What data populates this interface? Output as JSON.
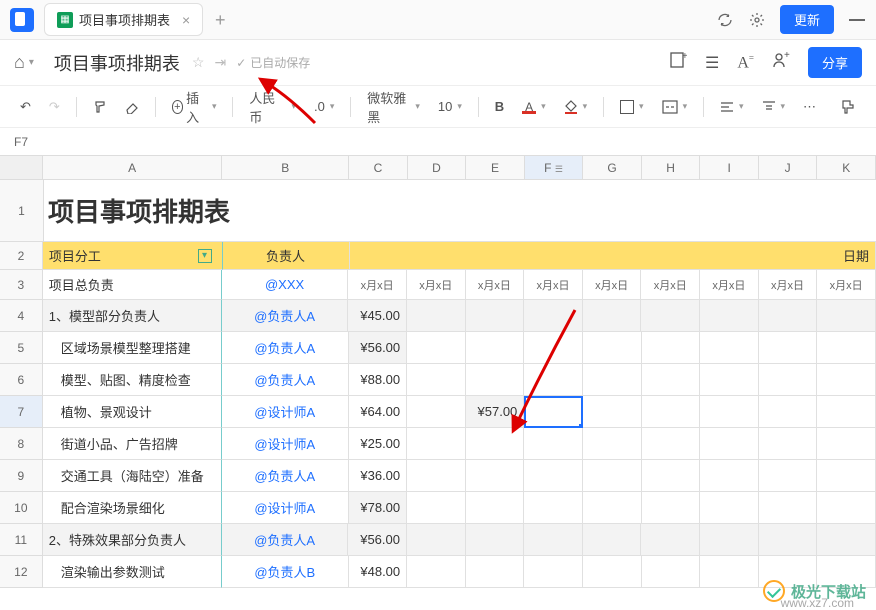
{
  "titlebar": {
    "tab_title": "项目事项排期表",
    "update_label": "更新"
  },
  "header": {
    "doc_title": "项目事项排期表",
    "saved_label": "已自动保存",
    "share_label": "分享"
  },
  "toolbar": {
    "insert_label": "插入",
    "currency_label": "人民币",
    "decimal_label": ".0",
    "font_label": "微软雅黑",
    "font_size": "10",
    "bold": "B",
    "text_color": "A"
  },
  "cellref": "F7",
  "columns": [
    "A",
    "B",
    "C",
    "D",
    "E",
    "F",
    "G",
    "H",
    "I",
    "J",
    "K"
  ],
  "col_widths": {
    "A": 184,
    "B": 130,
    "C": 60,
    "D": 60,
    "E": 60,
    "F": 60,
    "G": 60,
    "H": 60,
    "I": 60,
    "J": 60,
    "K": 60
  },
  "table_title": "项目事项排期表",
  "headers": {
    "a": "项目分工",
    "b": "负责人",
    "date": "日期"
  },
  "date_sub": "x月x日",
  "rows": [
    {
      "n": 3,
      "a": "项目总负责",
      "b": "@XXX",
      "c": "",
      "sub": true
    },
    {
      "n": 4,
      "a": "1、模型部分负责人",
      "b": "@负责人A",
      "c": "¥45.00",
      "gray": true
    },
    {
      "n": 5,
      "a": "区域场景模型整理搭建",
      "b": "@负责人A",
      "c": "¥56.00",
      "indent": true
    },
    {
      "n": 6,
      "a": "模型、贴图、精度检查",
      "b": "@负责人A",
      "c": "¥88.00",
      "indent": true
    },
    {
      "n": 7,
      "a": "植物、景观设计",
      "b": "@设计师A",
      "c": "¥64.00",
      "e": "¥57.00",
      "indent": true,
      "sel": true
    },
    {
      "n": 8,
      "a": "街道小品、广告招牌",
      "b": "@设计师A",
      "c": "¥25.00",
      "indent": true
    },
    {
      "n": 9,
      "a": "交通工具（海陆空）准备",
      "b": "@负责人A",
      "c": "¥36.00",
      "indent": true
    },
    {
      "n": 10,
      "a": "配合渲染场景细化",
      "b": "@设计师A",
      "c": "¥78.00",
      "indent": true
    },
    {
      "n": 11,
      "a": "2、特殊效果部分负责人",
      "b": "@负责人A",
      "c": "¥56.00",
      "gray": true
    },
    {
      "n": 12,
      "a": "渲染输出参数测试",
      "b": "@负责人B",
      "c": "¥48.00",
      "indent": true
    }
  ],
  "watermark": {
    "text": "极光下载站",
    "url": "www.xz7.com"
  },
  "chart_data": {
    "type": "table",
    "title": "项目事项排期表",
    "columns": [
      "项目分工",
      "负责人",
      "C",
      "D",
      "E",
      "F",
      "G",
      "H",
      "I",
      "J",
      "K"
    ],
    "header_row": [
      "项目分工",
      "负责人",
      "日期"
    ],
    "date_subheaders": [
      "x月x日",
      "x月x日",
      "x月x日",
      "x月x日",
      "x月x日",
      "x月x日",
      "x月x日",
      "x月x日",
      "x月x日"
    ],
    "records": [
      {
        "项目分工": "项目总负责",
        "负责人": "@XXX"
      },
      {
        "项目分工": "1、模型部分负责人",
        "负责人": "@负责人A",
        "C": 45.0
      },
      {
        "项目分工": "区域场景模型整理搭建",
        "负责人": "@负责人A",
        "C": 56.0
      },
      {
        "项目分工": "模型、贴图、精度检查",
        "负责人": "@负责人A",
        "C": 88.0
      },
      {
        "项目分工": "植物、景观设计",
        "负责人": "@设计师A",
        "C": 64.0,
        "E": 57.0
      },
      {
        "项目分工": "街道小品、广告招牌",
        "负责人": "@设计师A",
        "C": 25.0
      },
      {
        "项目分工": "交通工具（海陆空）准备",
        "负责人": "@负责人A",
        "C": 36.0
      },
      {
        "项目分工": "配合渲染场景细化",
        "负责人": "@设计师A",
        "C": 78.0
      },
      {
        "项目分工": "2、特殊效果部分负责人",
        "负责人": "@负责人A",
        "C": 56.0
      },
      {
        "项目分工": "渲染输出参数测试",
        "负责人": "@负责人B",
        "C": 48.0
      }
    ],
    "selected_cell": "F7",
    "currency": "人民币 ¥"
  }
}
